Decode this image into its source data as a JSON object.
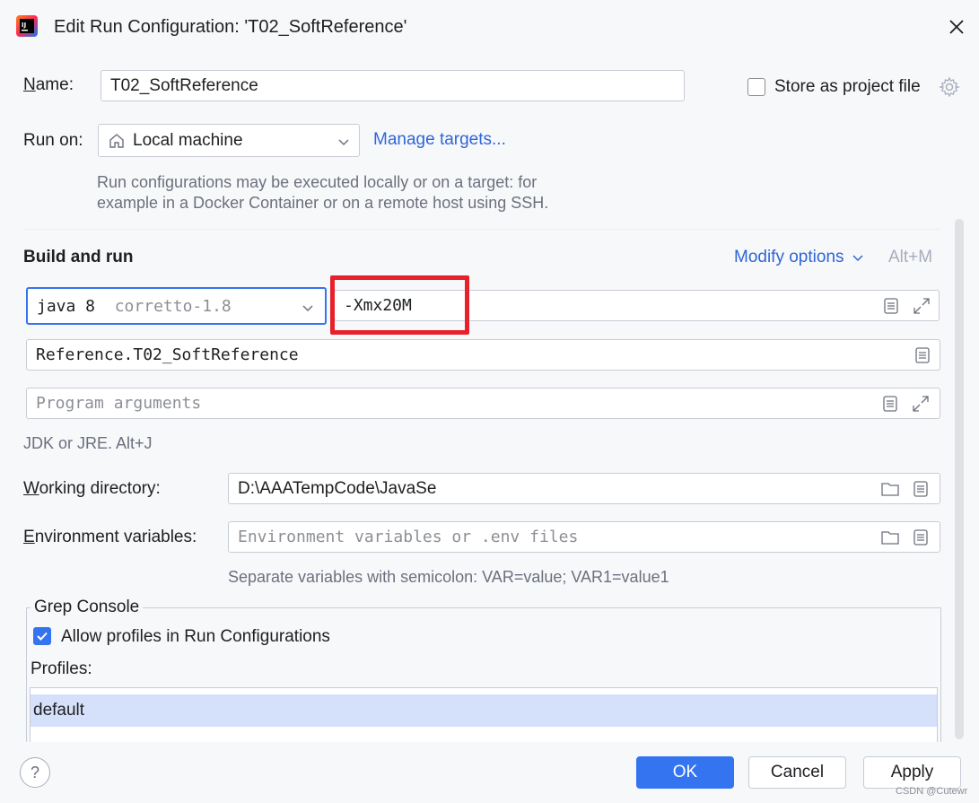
{
  "window": {
    "title": "Edit Run Configuration: 'T02_SoftReference'"
  },
  "name_row": {
    "label_first": "N",
    "label_rest": "ame:",
    "value": "T02_SoftReference",
    "store_label": "Store as project file",
    "store_checked": false
  },
  "run_on": {
    "label": "Run on:",
    "value": "Local machine",
    "manage_link": "Manage targets...",
    "hint_line1": "Run configurations may be executed locally or on a target: for",
    "hint_line2": "example in a Docker Container or on a remote host using SSH."
  },
  "build_and_run": {
    "title": "Build and run",
    "modify_options": "Modify options",
    "modify_shortcut": "Alt+M",
    "jdk_name": "java 8",
    "jdk_version": "corretto-1.8",
    "vm_options": "-Xmx20M",
    "main_class": "Reference.T02_SoftReference",
    "program_args_placeholder": "Program arguments",
    "jdk_hint": "JDK or JRE. Alt+J"
  },
  "working_directory": {
    "label_first": "W",
    "label_rest": "orking directory:",
    "value": "D:\\AAATempCode\\JavaSe"
  },
  "environment": {
    "label_first": "E",
    "label_rest": "nvironment variables:",
    "placeholder": "Environment variables or .env files",
    "hint": "Separate variables with semicolon: VAR=value; VAR1=value1"
  },
  "grep_console": {
    "title": "Grep Console",
    "allow_profiles_label": "Allow profiles in Run Configurations",
    "allow_profiles_checked": true,
    "profiles_label": "Profiles:",
    "profiles": [
      "default"
    ]
  },
  "footer": {
    "help": "?",
    "ok": "OK",
    "cancel": "Cancel",
    "apply": "Apply",
    "watermark": "CSDN @Cutewr"
  },
  "colors": {
    "accent": "#3574f0",
    "highlight_box": "#e8202a",
    "selected_row": "#d5e1fb",
    "link": "#2f66d6"
  }
}
